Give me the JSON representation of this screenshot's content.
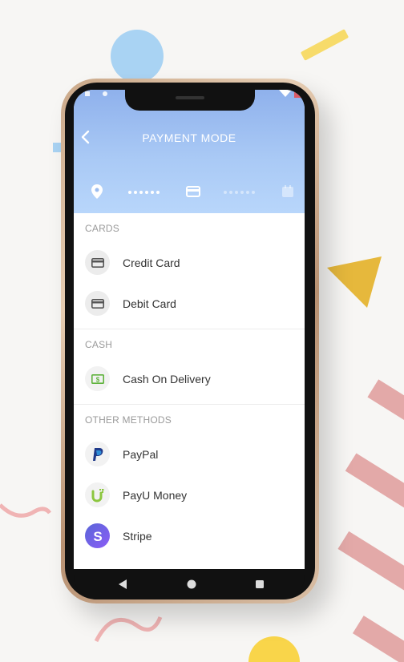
{
  "header": {
    "title": "PAYMENT MODE"
  },
  "sections": [
    {
      "title": "CARDS",
      "items": [
        {
          "label": "Credit Card",
          "icon": "credit-card-icon"
        },
        {
          "label": "Debit Card",
          "icon": "debit-card-icon"
        }
      ]
    },
    {
      "title": "CASH",
      "items": [
        {
          "label": "Cash On Delivery",
          "icon": "cash-icon"
        }
      ]
    },
    {
      "title": "OTHER METHODS",
      "items": [
        {
          "label": "PayPal",
          "icon": "paypal-icon"
        },
        {
          "label": "PayU Money",
          "icon": "payumoney-icon"
        },
        {
          "label": "Stripe",
          "icon": "stripe-icon"
        }
      ]
    }
  ],
  "colors": {
    "header_top": "#8fb1ec",
    "header_bottom": "#b8d6fb",
    "cash_green": "#5fb33d",
    "paypal_blue": "#1f3a8a",
    "payu_green": "#8cc63f",
    "stripe_purple": "#6b5fe0"
  },
  "progress": {
    "steps": [
      "location-pin-icon",
      "card-icon",
      "calendar-icon"
    ],
    "active_step": 2
  }
}
